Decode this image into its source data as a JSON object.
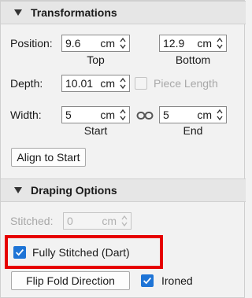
{
  "transformations": {
    "title": "Transformations",
    "position_label": "Position:",
    "position_top": {
      "value": "9.6",
      "unit": "cm"
    },
    "position_bottom": {
      "value": "12.9",
      "unit": "cm"
    },
    "top_label": "Top",
    "bottom_label": "Bottom",
    "depth_label": "Depth:",
    "depth": {
      "value": "10.01",
      "unit": "cm"
    },
    "piece_length_label": "Piece Length",
    "piece_length_checked": false,
    "width_label": "Width:",
    "width_start": {
      "value": "5",
      "unit": "cm"
    },
    "width_end": {
      "value": "5",
      "unit": "cm"
    },
    "start_label": "Start",
    "end_label": "End",
    "align_button": "Align to Start"
  },
  "draping": {
    "title": "Draping Options",
    "stitched_label": "Stitched:",
    "stitched": {
      "value": "0",
      "unit": "cm"
    },
    "fully_stitched_label": "Fully Stitched (Dart)",
    "fully_stitched_checked": true,
    "flip_button": "Flip Fold Direction",
    "ironed_label": "Ironed",
    "ironed_checked": true
  },
  "colors": {
    "accent": "#1e74d6",
    "highlight": "#e60000"
  }
}
